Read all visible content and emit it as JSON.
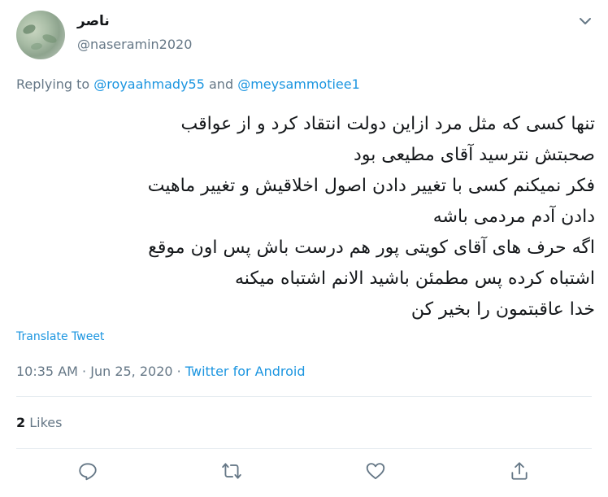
{
  "author": {
    "display_name": "ناصر",
    "handle": "@naseramin2020"
  },
  "reply": {
    "prefix": "Replying to",
    "mention1": "@royaahmady55",
    "conjunction": "and",
    "mention2": "@meysammotiee1"
  },
  "tweet": {
    "lines": [
      "تنها کسی که مثل مرد ازاین دولت انتقاد کرد و از عواقب",
      "صحبتش نترسید آقای مطیعی بود",
      "فکر نمیکنم کسی با تغییر دادن اصول اخلاقیش و تغییر ماهیت",
      "دادن آدم مردمی باشه",
      "اگه حرف های آقای کویتی پور هم درست باش پس اون موقع",
      "اشتباه کرده پس مطمئن باشید الانم اشتباه میکنه",
      "خدا عاقبتمون را بخیر کن"
    ],
    "translate_label": "Translate Tweet",
    "time": "10:35 AM",
    "separator1": "·",
    "date": "Jun 25, 2020",
    "separator2": "·",
    "source": "Twitter for Android"
  },
  "stats": {
    "likes_count": "2",
    "likes_label": "Likes"
  },
  "actions": {
    "reply_icon": "reply-icon",
    "retweet_icon": "retweet-icon",
    "like_icon": "heart-icon",
    "share_icon": "share-icon"
  },
  "colors": {
    "link": "#1b95e0",
    "muted": "#657786",
    "text": "#14171a",
    "divider": "#e6ecf0"
  }
}
